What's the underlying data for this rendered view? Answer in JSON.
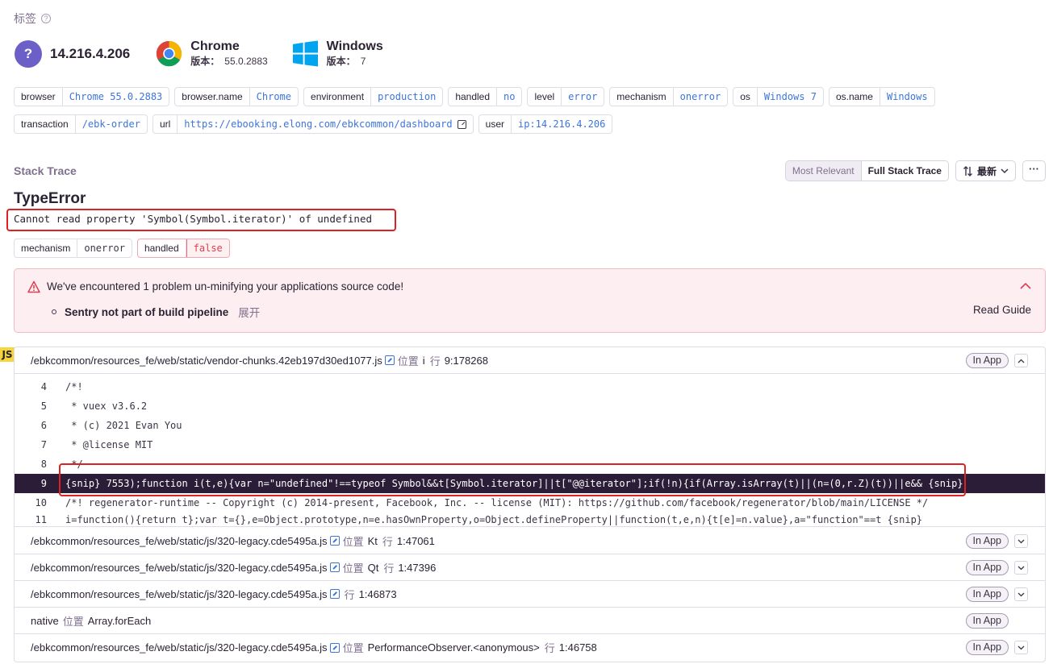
{
  "tags_header": {
    "title": "标签",
    "help": "?"
  },
  "contexts": {
    "user": {
      "icon": "?",
      "ip": "14.216.4.206"
    },
    "browser": {
      "name": "Chrome",
      "version_label": "版本：",
      "version": "55.0.2883",
      "icon": "chrome-icon"
    },
    "os": {
      "name": "Windows",
      "version_label": "版本：",
      "version": "7",
      "icon": "windows-icon"
    }
  },
  "tags": [
    [
      {
        "key": "browser",
        "value": "Chrome 55.0.2883"
      },
      {
        "key": "browser.name",
        "value": "Chrome"
      },
      {
        "key": "environment",
        "value": "production"
      },
      {
        "key": "handled",
        "value": "no"
      },
      {
        "key": "level",
        "value": "error"
      },
      {
        "key": "mechanism",
        "value": "onerror"
      },
      {
        "key": "os",
        "value": "Windows 7"
      },
      {
        "key": "os.name",
        "value": "Windows"
      }
    ],
    [
      {
        "key": "transaction",
        "value": "/ebk-order"
      },
      {
        "key": "url",
        "value": "https://ebooking.elong.com/ebkcommon/dashboard",
        "link": true
      },
      {
        "key": "user",
        "value": "ip:14.216.4.206"
      }
    ]
  ],
  "stack_trace": {
    "title": "Stack Trace",
    "toggle": {
      "relevant": "Most Relevant",
      "full": "Full Stack Trace"
    },
    "sort": "最新",
    "more": "···"
  },
  "error": {
    "type": "TypeError",
    "message": "Cannot read property 'Symbol(Symbol.iterator)' of undefined",
    "mechanism": {
      "key": "mechanism",
      "value": "onerror"
    },
    "handled": {
      "key": "handled",
      "value": "false"
    }
  },
  "alert": {
    "title": "We've encountered 1 problem un-minifying your applications source code!",
    "item": "Sentry not part of build pipeline",
    "expand": "展开",
    "guide": "Read Guide"
  },
  "frames_badge": "JS",
  "in_app_label": "In App",
  "first_frame": {
    "path": "/ebkcommon/resources_fe/web/static/vendor-chunks.42eb197d30ed1077.js",
    "at_label": "位置",
    "fn": "i",
    "line_label": "行",
    "line": "9:178268"
  },
  "code_lines": [
    {
      "no": "4",
      "text": "/*!"
    },
    {
      "no": "5",
      "text": " * vuex v3.6.2"
    },
    {
      "no": "6",
      "text": " * (c) 2021 Evan You"
    },
    {
      "no": "7",
      "text": " * @license MIT"
    },
    {
      "no": "8",
      "text": " */"
    },
    {
      "no": "9",
      "text": "{snip} 7553);function i(t,e){var n=\"undefined\"!==typeof Symbol&&t[Symbol.iterator]||t[\"@@iterator\"];if(!n){if(Array.isArray(t)||(n=(0,r.Z)(t))||e&& {snip}"
    },
    {
      "no": "10",
      "text": "/*! regenerator-runtime -- Copyright (c) 2014-present, Facebook, Inc. -- license (MIT): https://github.com/facebook/regenerator/blob/main/LICENSE */"
    },
    {
      "no": "11",
      "text": "i=function(){return t};var t={},e=Object.prototype,n=e.hasOwnProperty,o=Object.defineProperty||function(t,e,n){t[e]=n.value},a=\"function\"==t {snip}"
    }
  ],
  "frames": [
    {
      "path": "/ebkcommon/resources_fe/web/static/js/320-legacy.cde5495a.js",
      "at_label": "位置",
      "fn": "Kt",
      "line_label": "行",
      "line": "1:47061"
    },
    {
      "path": "/ebkcommon/resources_fe/web/static/js/320-legacy.cde5495a.js",
      "at_label": "位置",
      "fn": "Qt",
      "line_label": "行",
      "line": "1:47396"
    },
    {
      "path": "/ebkcommon/resources_fe/web/static/js/320-legacy.cde5495a.js",
      "at_label": "",
      "fn": "",
      "line_label": "行",
      "line": "1:46873"
    },
    {
      "path": "native",
      "at_label": "位置",
      "fn": "Array.forEach",
      "line_label": "",
      "line": ""
    },
    {
      "path": "/ebkcommon/resources_fe/web/static/js/320-legacy.cde5495a.js",
      "at_label": "位置",
      "fn": "PerformanceObserver.<anonymous>",
      "line_label": "行",
      "line": "1:46758"
    }
  ]
}
